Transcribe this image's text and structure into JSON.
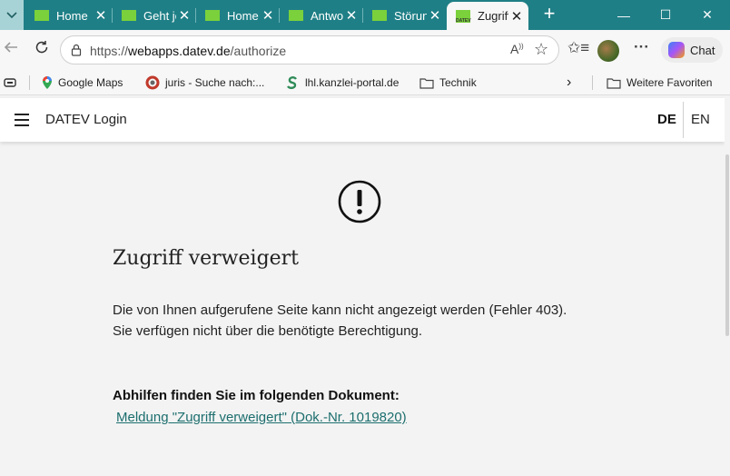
{
  "browser": {
    "tabs": [
      {
        "title": "Home"
      },
      {
        "title": "Geht je"
      },
      {
        "title": "Home"
      },
      {
        "title": "Antwo"
      },
      {
        "title": "Störun"
      },
      {
        "title": "Zugriff",
        "favicon_text": "DATEV"
      }
    ],
    "window_buttons": {
      "minimize": "—",
      "maximize": "☐",
      "close": "✕"
    },
    "address": {
      "prefix": "https://",
      "host": "webapps.datev.de",
      "path": "/authorize"
    },
    "chat_label": "Chat"
  },
  "bookmarks": {
    "items": [
      {
        "label": "Google Maps"
      },
      {
        "label": "juris - Suche nach:..."
      },
      {
        "label": "lhl.kanzlei-portal.de"
      },
      {
        "label": "Technik"
      }
    ],
    "overflow_label": "Weitere Favoriten"
  },
  "page": {
    "app_title": "DATEV Login",
    "lang_de": "DE",
    "lang_en": "EN",
    "error_title": "Zugriff verweigert",
    "error_line1": "Die von Ihnen aufgerufene Seite kann nicht angezeigt werden (Fehler 403).",
    "error_line2": "Sie verfügen nicht über die benötigte Berechtigung.",
    "help_heading": "Abhilfen finden Sie im folgenden Dokument:",
    "help_link": "Meldung \"Zugriff verweigert\" (Dok.-Nr. 1019820)"
  },
  "colors": {
    "tabstrip": "#1f7f86",
    "favicon_green": "#7ad13b",
    "link": "#1d6e6e"
  }
}
